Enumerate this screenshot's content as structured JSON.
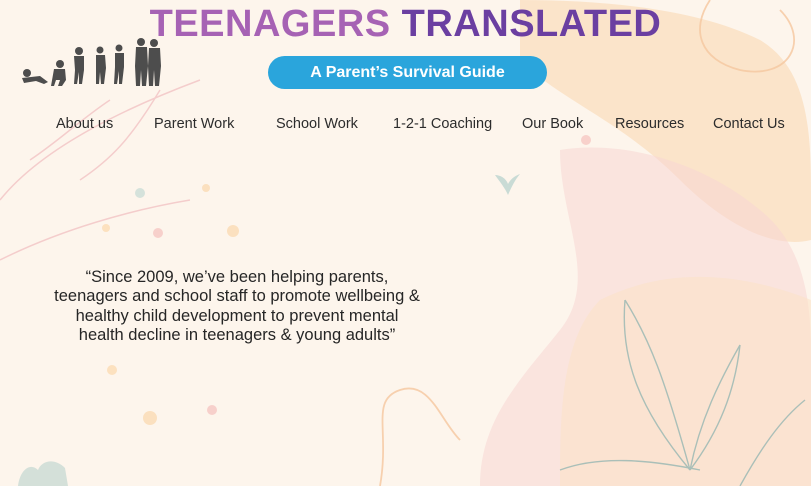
{
  "header": {
    "title_part1": "TEENAGERS",
    "title_part2": "TRANSLATED",
    "subtitle": "A Parent’s Survival Guide"
  },
  "nav": {
    "items": [
      "About us",
      "Parent Work",
      "School Work",
      "1-2-1 Coaching",
      "Our Book",
      "Resources",
      "Contact Us"
    ]
  },
  "hero": {
    "quote": "“Since 2009, we’ve been helping parents, teenagers and school staff to promote wellbeing & healthy child development to prevent mental health decline in teenagers & young adults”"
  },
  "colors": {
    "background": "#fdf5ec",
    "title_light_purple": "#a662b4",
    "title_dark_purple": "#6b3fa1",
    "pill_blue": "#2aa5dc",
    "blob_peach": "#fbe2c6",
    "blob_pink": "#f8d6d3",
    "leaf_sage": "#9cb9b4"
  },
  "icons": {
    "logo": "family-silhouettes-icon"
  }
}
